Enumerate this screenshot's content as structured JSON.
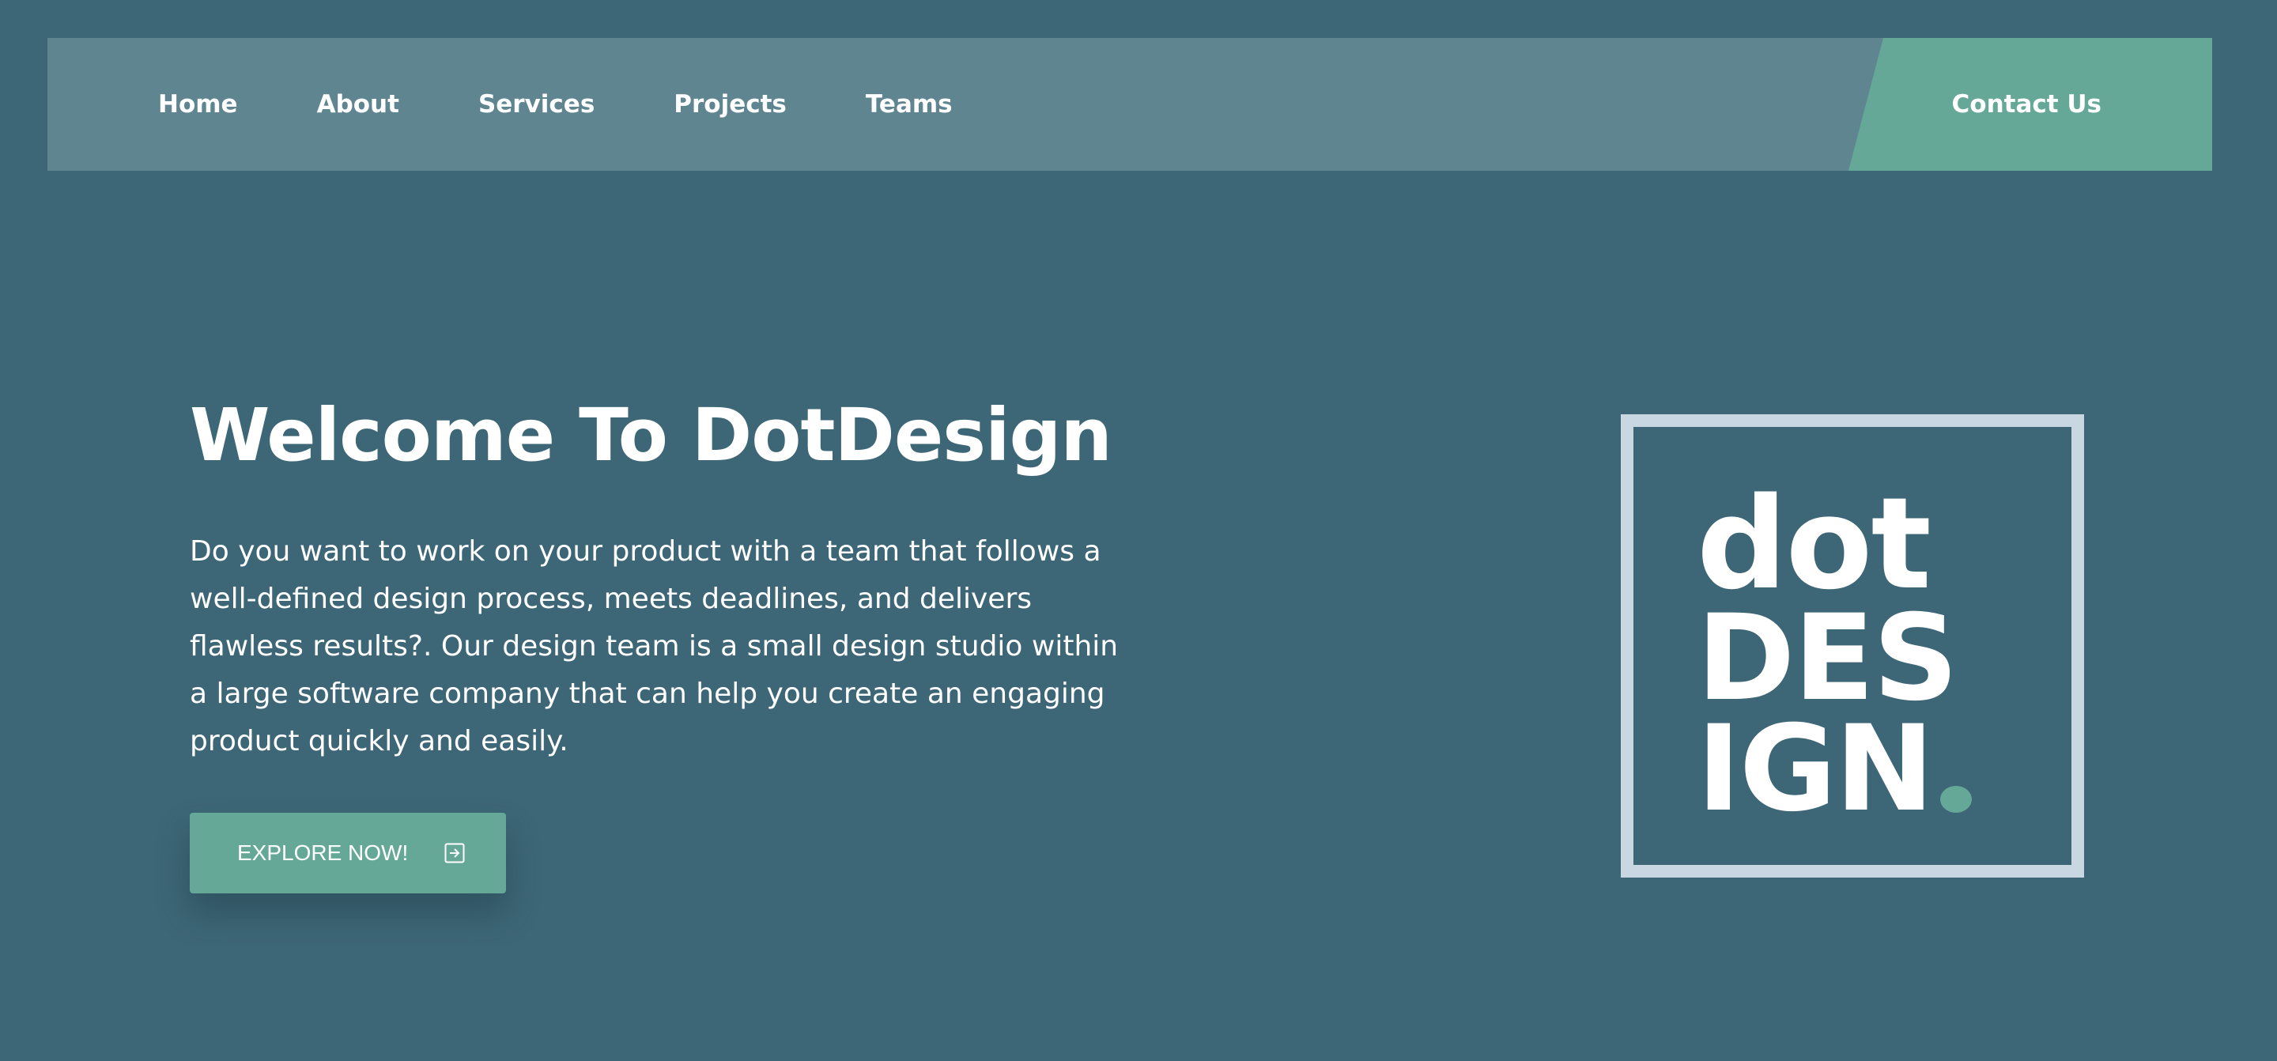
{
  "nav": {
    "links": [
      "Home",
      "About",
      "Services",
      "Projects",
      "Teams"
    ],
    "cta_label": "Contact Us"
  },
  "hero": {
    "title": "Welcome To DotDesign",
    "description": "Do you want to work on your product with a team that follows a well-defined design process, meets deadlines, and delivers flawless results?. Our design team is a small design studio within a large software company that can help you create an engaging product quickly and easily.",
    "button_label": "EXPLORE NOW!",
    "button_icon": "arrow-in-square-icon"
  },
  "logo": {
    "line1": "dot",
    "line2": "DES",
    "line3": "IGN"
  },
  "colors": {
    "background": "#3d6676",
    "navbar": "#5f8591",
    "accent": "#66a898",
    "logo_frame": "#c9d7e3",
    "text": "#ffffff"
  }
}
